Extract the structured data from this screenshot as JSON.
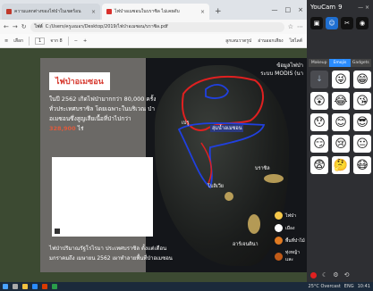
{
  "browser": {
    "tabs": [
      {
        "label": "ความแตกต่างของไฟป่าในเขตร้อน",
        "active": false
      },
      {
        "label": "ไฟป่าอเมซอนในบราซิล ไม่เคยดับ",
        "active": true
      }
    ],
    "new_tab": "+",
    "url_label": "ไฟล์",
    "url": "C:/Users/ครูเอมอร/Desktop/2019/ไฟป่าอเมซอน/บราซิล.pdf",
    "page_label": "เลือก",
    "page_current": "1",
    "page_total": "จาก 8",
    "zoom_minus": "−",
    "zoom_plus": "+",
    "draw_label": "ลูกเลนวาดรูป",
    "read_label": "อ่านออกเสียง",
    "highlight_label": "ไฮไลต์",
    "window_controls": [
      "—",
      "□",
      "×"
    ]
  },
  "slide": {
    "heading": "ไฟป่าอเมซอน",
    "paragraph": "ในปี 2562 เกิดไฟป่ามากกว่า 80,000 ครั้ง ทั่วประเทศบราซิล โดยเฉพาะในบริเวณ ป่าอเมซอนซึ่งสูญเสียเนื้อที่ป่าไปกว่า",
    "area": "328,900",
    "area_unit": "ไร่",
    "caption_line1": "ไฟป่าปริมาณรัฐโรไรมา ประเทศบราซิล ตั้งแต่เดือนมกราคม",
    "caption_line2": "ถึง เมษายน 2562  เผาทำลายพื้นที่ป่าอเมซอน",
    "map_title_line1": "ข้อมูลไฟป่า",
    "map_title_line2": "ระบบ MODIS (นา",
    "labels": {
      "amazon": "ลุ่มน้ำอเมซอน",
      "peru": "เปรู",
      "brazil": "บราซิล",
      "bolivia": "โบลิเวีย",
      "argentina": "อาร์เจนตินา"
    },
    "legend": [
      {
        "label": "ไฟป่า",
        "color": "#f5c84a"
      },
      {
        "label": "เมือง",
        "color": "#ffffff"
      },
      {
        "label": "พื้นที่ป่าไม้",
        "color": "#e07a22"
      },
      {
        "label": "ทุ่งหญ้าและ",
        "color": "#c05a18"
      }
    ]
  },
  "youcam": {
    "title": "YouCam",
    "version": "9",
    "modes": [
      "▣",
      "☺",
      "✂",
      "◉"
    ],
    "tabs": [
      "Makeup",
      "Emojis",
      "Gadgets"
    ],
    "emojis": [
      "↓",
      "😜",
      "😁",
      "😲",
      "😂",
      "😘",
      "😯",
      "😊",
      "😎",
      "😏",
      "😢",
      "😐",
      "😨",
      "🤔",
      "😷"
    ],
    "bottom": [
      "●",
      "☾",
      "⚙",
      "⟲"
    ]
  },
  "taskbar": {
    "search": "Type here to search",
    "weather": "25°C  Overcast",
    "time": "10:41",
    "date": "25/4/2021",
    "lang": "ENG"
  },
  "colors": {
    "heading_red": "#d63a2f",
    "area_red": "#e05a3c",
    "route_red": "#e02020",
    "route_blue": "#2040e0",
    "youcam_accent": "#2a8cff"
  }
}
